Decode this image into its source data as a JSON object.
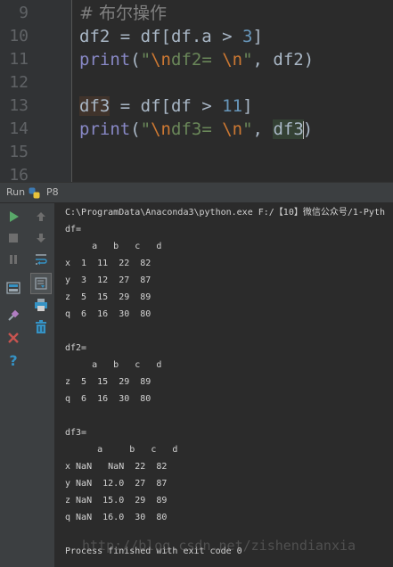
{
  "editor": {
    "lines": [
      {
        "num": "9",
        "tokens": [
          {
            "t": "# 布尔操作",
            "c": "tok-comment"
          }
        ]
      },
      {
        "num": "10",
        "tokens": [
          {
            "t": "df2 = df[df.a > ",
            "c": ""
          },
          {
            "t": "3",
            "c": "tok-num"
          },
          {
            "t": "]",
            "c": ""
          }
        ]
      },
      {
        "num": "11",
        "tokens": [
          {
            "t": "print",
            "c": "tok-builtin"
          },
          {
            "t": "(",
            "c": ""
          },
          {
            "t": "\"",
            "c": "tok-str"
          },
          {
            "t": "\\n",
            "c": "tok-esc"
          },
          {
            "t": "df2= ",
            "c": "tok-str"
          },
          {
            "t": "\\n",
            "c": "tok-esc"
          },
          {
            "t": "\"",
            "c": "tok-str"
          },
          {
            "t": ", df2)",
            "c": ""
          }
        ]
      },
      {
        "num": "12",
        "tokens": []
      },
      {
        "num": "13",
        "tokens": [
          {
            "t": "df3",
            "c": "hl-var"
          },
          {
            "t": " = df[df > ",
            "c": ""
          },
          {
            "t": "11",
            "c": "tok-num"
          },
          {
            "t": "]",
            "c": ""
          }
        ]
      },
      {
        "num": "14",
        "tokens": [
          {
            "t": "print",
            "c": "tok-builtin"
          },
          {
            "t": "(",
            "c": ""
          },
          {
            "t": "\"",
            "c": "tok-str"
          },
          {
            "t": "\\n",
            "c": "tok-esc"
          },
          {
            "t": "df3= ",
            "c": "tok-str"
          },
          {
            "t": "\\n",
            "c": "tok-esc"
          },
          {
            "t": "\"",
            "c": "tok-str"
          },
          {
            "t": ", ",
            "c": ""
          },
          {
            "t": "df3",
            "c": "hl"
          },
          {
            "t": "CARET",
            "c": ""
          },
          {
            "t": ")",
            "c": ""
          }
        ]
      },
      {
        "num": "15",
        "tokens": []
      },
      {
        "num": "16",
        "tokens": []
      }
    ]
  },
  "run": {
    "label": "Run",
    "config": "P8"
  },
  "toolbar_icons": {
    "left": [
      "run-icon",
      "stop-icon",
      "pause-icon",
      "layout-icon",
      "pin-icon",
      "close-icon",
      "help-icon"
    ],
    "right": [
      "up-arrow-icon",
      "down-arrow-icon",
      "soft-wrap-icon",
      "scroll-to-end-icon",
      "print-icon",
      "trash-icon"
    ]
  },
  "console": {
    "lines": [
      "C:\\ProgramData\\Anaconda3\\python.exe F:/【10】微信公众号/1-Pyth",
      "df=",
      "     a   b   c   d",
      "x  1  11  22  82",
      "y  3  12  27  87",
      "z  5  15  29  89",
      "q  6  16  30  80",
      "",
      "df2=",
      "     a   b   c   d",
      "z  5  15  29  89",
      "q  6  16  30  80",
      "",
      "df3=",
      "      a     b   c   d",
      "x NaN   NaN  22  82",
      "y NaN  12.0  27  87",
      "z NaN  15.0  29  89",
      "q NaN  16.0  30  80",
      "",
      "Process finished with exit code 0"
    ],
    "watermark": "http://blog.csdn.net/zishendianxia"
  },
  "colors": {
    "editor_bg": "#2b2b2b",
    "gutter_bg": "#313335",
    "panel_bg": "#3c3f41",
    "run_green": "#59a869",
    "close_red": "#c75450",
    "help_blue": "#3592c4"
  }
}
